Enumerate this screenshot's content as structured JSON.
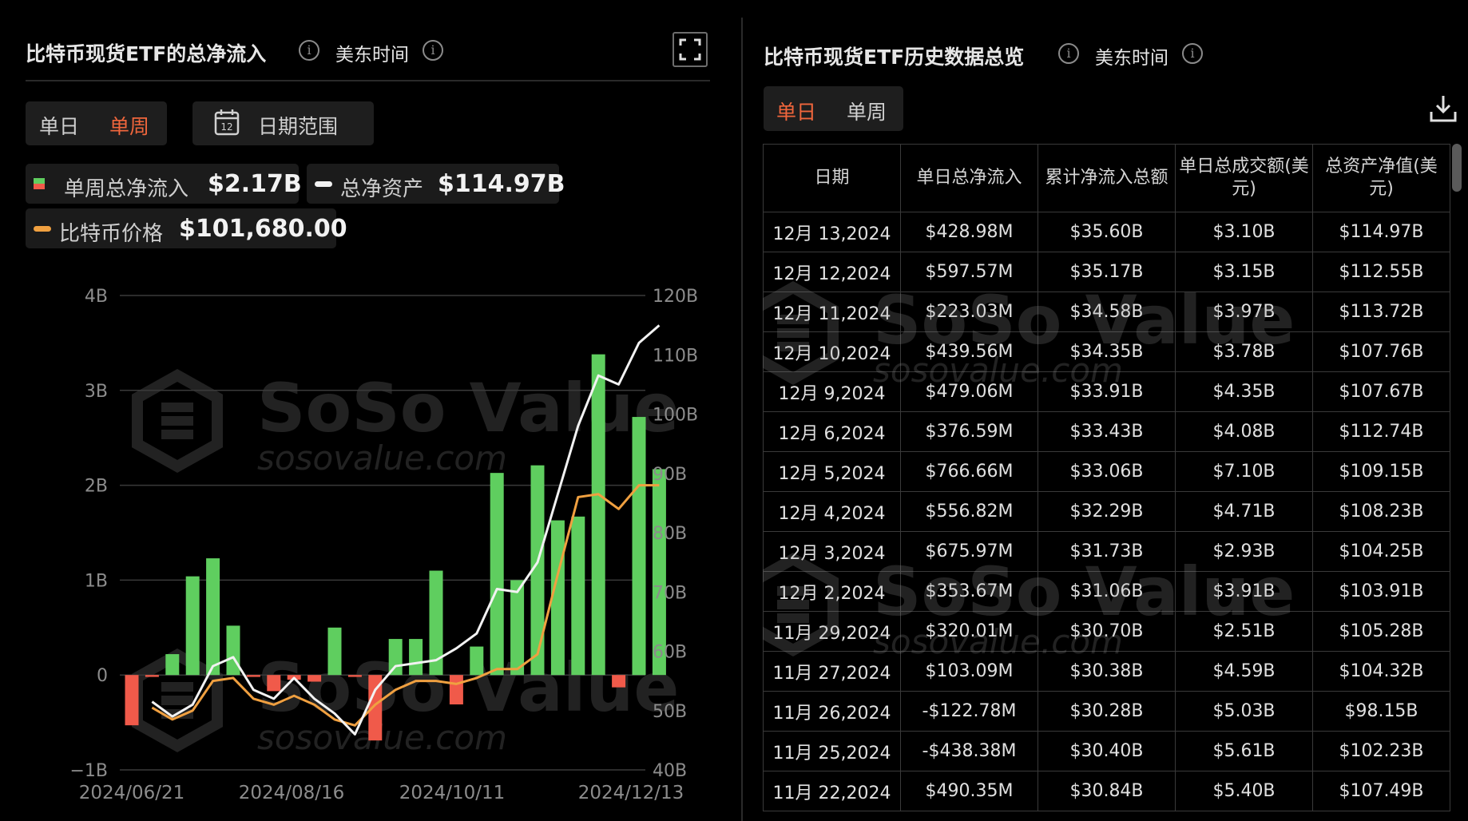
{
  "left_panel": {
    "title": "比特币现货ETF的总净流入",
    "timezone": "美东时间",
    "tabs": [
      "单日",
      "单周"
    ],
    "active_tab": "单周",
    "date_range_label": "日期范围",
    "date_range_icon_text": "12",
    "legend": [
      {
        "label": "单周总净流入",
        "value": "$2.17B",
        "icon": "bar-swatch-green-red"
      },
      {
        "label": "总净资产",
        "value": "$114.97B",
        "icon": "line-swatch-white"
      },
      {
        "label": "比特币价格",
        "value": "$101,680.00",
        "icon": "line-swatch-orange"
      }
    ]
  },
  "watermark": {
    "brand": "SoSo Value",
    "url": "sosovalue.com"
  },
  "colors": {
    "positive": "#5fce5f",
    "negative": "#f05a4a",
    "accent": "#f0663c",
    "net_assets_line": "#f2f2f2",
    "btc_price_line": "#f0a040"
  },
  "chart_data": {
    "type": "bar",
    "x_tick_labels": [
      "2024/06/21",
      "2024/08/16",
      "2024/10/11",
      "2024/12/13"
    ],
    "y_left": {
      "ticks": [
        "4B",
        "3B",
        "2B",
        "1B",
        "0",
        "−1B"
      ],
      "range": [
        -1,
        4
      ],
      "unit": "B"
    },
    "y_right": {
      "ticks": [
        "120B",
        "110B",
        "100B",
        "90B",
        "80B",
        "70B",
        "60B",
        "50B",
        "40B"
      ],
      "range": [
        40,
        120
      ],
      "unit": "B"
    },
    "grid": true,
    "weeks": 26,
    "series": [
      {
        "name": "单周总净流入",
        "type": "bar",
        "axis": "left",
        "values": [
          -0.53,
          -0.02,
          0.22,
          1.04,
          1.23,
          0.52,
          -0.02,
          -0.17,
          -0.05,
          -0.07,
          0.5,
          -0.02,
          -0.69,
          0.38,
          0.38,
          1.1,
          -0.31,
          0.3,
          2.13,
          1.0,
          2.21,
          1.63,
          1.67,
          3.38,
          -0.13,
          2.72,
          2.17
        ]
      },
      {
        "name": "总净资产",
        "type": "line",
        "axis": "right",
        "values": [
          null,
          51.5,
          49.0,
          51.0,
          57.5,
          59.0,
          53.5,
          52.0,
          55.5,
          52.0,
          49.5,
          46.0,
          53.5,
          57.5,
          58.0,
          58.5,
          60.5,
          63.0,
          70.5,
          70.0,
          75.0,
          86.5,
          98.0,
          106.5,
          105.0,
          112.0,
          114.97
        ]
      },
      {
        "name": "比特币价格",
        "type": "line",
        "axis": "right",
        "values": [
          null,
          50.5,
          48.5,
          50.0,
          55.0,
          55.5,
          52.0,
          51.0,
          52.5,
          51.0,
          48.5,
          47.5,
          51.0,
          53.5,
          55.0,
          55.0,
          54.5,
          55.5,
          57.0,
          57.0,
          59.5,
          73.0,
          86.0,
          86.5,
          84.0,
          88.0,
          88.0
        ]
      }
    ]
  },
  "right_panel": {
    "title": "比特币现货ETF历史数据总览",
    "timezone": "美东时间",
    "tabs": [
      "单日",
      "单周"
    ],
    "active_tab": "单日",
    "download_icon": "download-icon",
    "columns": [
      "日期",
      "单日总净流入",
      "累计净流入总额",
      "单日总成交额(美元)",
      "总资产净值(美元)"
    ],
    "rows": [
      {
        "date": "12月 13,2024",
        "inflow": "$428.98M",
        "cum": "$35.60B",
        "volume": "$3.10B",
        "nav": "$114.97B",
        "sign": "pos"
      },
      {
        "date": "12月 12,2024",
        "inflow": "$597.57M",
        "cum": "$35.17B",
        "volume": "$3.15B",
        "nav": "$112.55B",
        "sign": "pos"
      },
      {
        "date": "12月 11,2024",
        "inflow": "$223.03M",
        "cum": "$34.58B",
        "volume": "$3.97B",
        "nav": "$113.72B",
        "sign": "pos"
      },
      {
        "date": "12月 10,2024",
        "inflow": "$439.56M",
        "cum": "$34.35B",
        "volume": "$3.78B",
        "nav": "$107.76B",
        "sign": "pos"
      },
      {
        "date": "12月 9,2024",
        "inflow": "$479.06M",
        "cum": "$33.91B",
        "volume": "$4.35B",
        "nav": "$107.67B",
        "sign": "pos"
      },
      {
        "date": "12月 6,2024",
        "inflow": "$376.59M",
        "cum": "$33.43B",
        "volume": "$4.08B",
        "nav": "$112.74B",
        "sign": "pos"
      },
      {
        "date": "12月 5,2024",
        "inflow": "$766.66M",
        "cum": "$33.06B",
        "volume": "$7.10B",
        "nav": "$109.15B",
        "sign": "pos"
      },
      {
        "date": "12月 4,2024",
        "inflow": "$556.82M",
        "cum": "$32.29B",
        "volume": "$4.71B",
        "nav": "$108.23B",
        "sign": "pos"
      },
      {
        "date": "12月 3,2024",
        "inflow": "$675.97M",
        "cum": "$31.73B",
        "volume": "$2.93B",
        "nav": "$104.25B",
        "sign": "pos"
      },
      {
        "date": "12月 2,2024",
        "inflow": "$353.67M",
        "cum": "$31.06B",
        "volume": "$3.91B",
        "nav": "$103.91B",
        "sign": "pos"
      },
      {
        "date": "11月 29,2024",
        "inflow": "$320.01M",
        "cum": "$30.70B",
        "volume": "$2.51B",
        "nav": "$105.28B",
        "sign": "pos"
      },
      {
        "date": "11月 27,2024",
        "inflow": "$103.09M",
        "cum": "$30.38B",
        "volume": "$4.59B",
        "nav": "$104.32B",
        "sign": "pos"
      },
      {
        "date": "11月 26,2024",
        "inflow": "-$122.78M",
        "cum": "$30.28B",
        "volume": "$5.03B",
        "nav": "$98.15B",
        "sign": "neg"
      },
      {
        "date": "11月 25,2024",
        "inflow": "-$438.38M",
        "cum": "$30.40B",
        "volume": "$5.61B",
        "nav": "$102.23B",
        "sign": "neg"
      },
      {
        "date": "11月 22,2024",
        "inflow": "$490.35M",
        "cum": "$30.84B",
        "volume": "$5.40B",
        "nav": "$107.49B",
        "sign": "pos"
      }
    ]
  }
}
